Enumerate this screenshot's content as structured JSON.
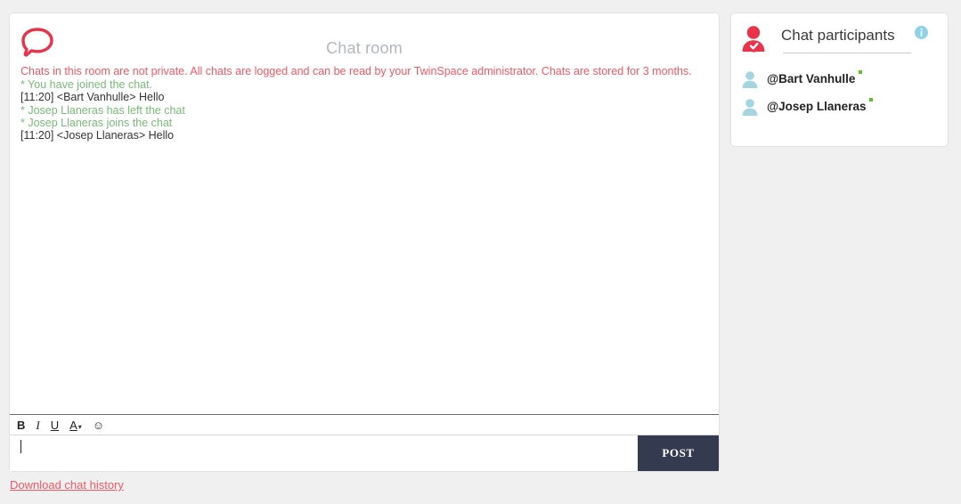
{
  "chat": {
    "icon": "speech-bubble-icon",
    "title": "Chat room",
    "log": [
      {
        "kind": "warning",
        "text": "Chats in this room are not private. All chats are logged and can be read by your TwinSpace administrator. Chats are stored for 3 months."
      },
      {
        "kind": "system",
        "text": "* You have joined the chat."
      },
      {
        "kind": "message",
        "text": "[11:20] <Bart Vanhulle> Hello"
      },
      {
        "kind": "system",
        "text": "* Josep Llaneras has left the chat"
      },
      {
        "kind": "system",
        "text": "* Josep Llaneras joins the chat"
      },
      {
        "kind": "message",
        "text": "[11:20] <Josep Llaneras> Hello"
      }
    ],
    "toolbar": {
      "bold_label": "B",
      "italic_label": "I",
      "underline_label": "U",
      "color_label": "A",
      "color_caret": "▾",
      "emoji_label": "☺"
    },
    "input": {
      "value": "",
      "placeholder": ""
    },
    "post_label": "POST",
    "download_label": "Download chat history"
  },
  "participants": {
    "icon": "person-check-icon",
    "title": "Chat participants",
    "info_icon": "info-icon",
    "items": [
      {
        "name": "@Bart Vanhulle",
        "status": "online"
      },
      {
        "name": "@Josep Llaneras",
        "status": "online"
      }
    ]
  },
  "colors": {
    "background": "#f0f0f0",
    "panel": "#ffffff",
    "accent_red": "#e8334a",
    "warning_text": "#ef5a66",
    "system_text": "#7ab87a",
    "message_text": "#333333",
    "title_gray": "#b4b7bd",
    "post_button": "#343a4f",
    "avatar_blue": "#a6d5e0",
    "status_green": "#5fc02a",
    "info_blue": "#8fd3e8"
  }
}
